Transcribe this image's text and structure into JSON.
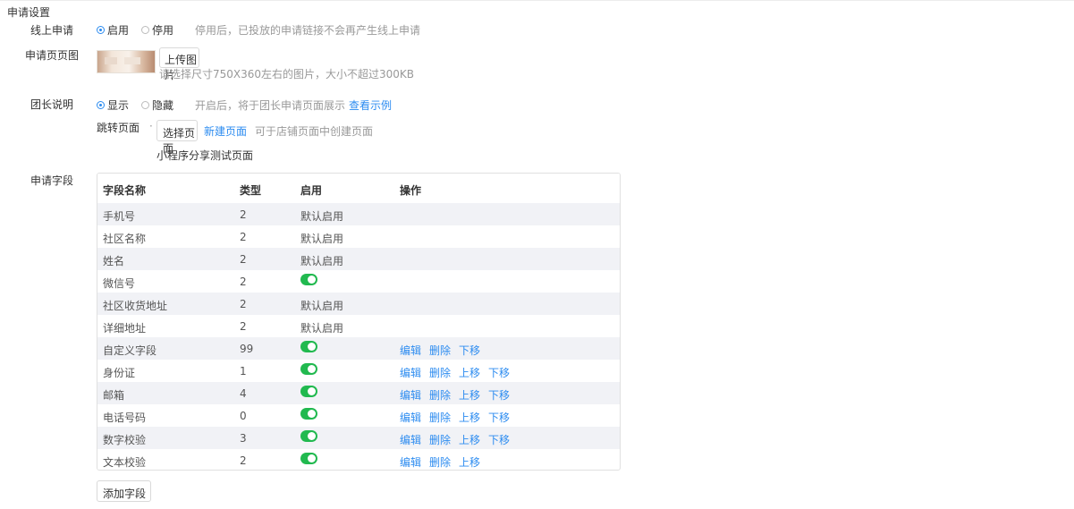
{
  "section_title": "申请设置",
  "online_apply": {
    "label": "线上申请",
    "option_on": "启用",
    "option_off": "停用",
    "hint": "停用后，已投放的申请链接不会再产生线上申请"
  },
  "apply_image": {
    "label": "申请页页图",
    "upload_button": "上传图片",
    "hint": "请选择尺寸750X360左右的图片，大小不超过300KB"
  },
  "leader_desc": {
    "label": "团长说明",
    "option_show": "显示",
    "option_hide": "隐藏",
    "hint": "开启后，将于团长申请页面展示",
    "example_link": "查看示例"
  },
  "jump_page": {
    "label": "跳转页面",
    "required_mark": "·",
    "select_button": "选择页面",
    "new_page_link": "新建页面",
    "hint": "可于店铺页面中创建页面",
    "selected_page": "小程序分享测试页面"
  },
  "fields": {
    "label": "申请字段",
    "headers": [
      "字段名称",
      "类型",
      "启用",
      "操作"
    ],
    "rows": [
      {
        "name": "手机号",
        "type": "2",
        "enabled": "默认启用",
        "toggle": false,
        "actions": []
      },
      {
        "name": "社区名称",
        "type": "2",
        "enabled": "默认启用",
        "toggle": false,
        "actions": []
      },
      {
        "name": "姓名",
        "type": "2",
        "enabled": "默认启用",
        "toggle": false,
        "actions": []
      },
      {
        "name": "微信号",
        "type": "2",
        "enabled": "",
        "toggle": true,
        "actions": []
      },
      {
        "name": "社区收货地址",
        "type": "2",
        "enabled": "默认启用",
        "toggle": false,
        "actions": []
      },
      {
        "name": "详细地址",
        "type": "2",
        "enabled": "默认启用",
        "toggle": false,
        "actions": []
      },
      {
        "name": "自定义字段",
        "type": "99",
        "enabled": "",
        "toggle": true,
        "actions": [
          "编辑",
          "删除",
          "下移"
        ]
      },
      {
        "name": "身份证",
        "type": "1",
        "enabled": "",
        "toggle": true,
        "actions": [
          "编辑",
          "删除",
          "上移",
          "下移"
        ]
      },
      {
        "name": "邮箱",
        "type": "4",
        "enabled": "",
        "toggle": true,
        "actions": [
          "编辑",
          "删除",
          "上移",
          "下移"
        ]
      },
      {
        "name": "电话号码",
        "type": "0",
        "enabled": "",
        "toggle": true,
        "actions": [
          "编辑",
          "删除",
          "上移",
          "下移"
        ]
      },
      {
        "name": "数字校验",
        "type": "3",
        "enabled": "",
        "toggle": true,
        "actions": [
          "编辑",
          "删除",
          "上移",
          "下移"
        ]
      },
      {
        "name": "文本校验",
        "type": "2",
        "enabled": "",
        "toggle": true,
        "actions": [
          "编辑",
          "删除",
          "上移"
        ]
      }
    ],
    "add_button": "添加字段"
  },
  "colors": {
    "link": "#2d8cf0",
    "toggle_on": "#21b94f",
    "row_alt": "#f1f2f6"
  }
}
